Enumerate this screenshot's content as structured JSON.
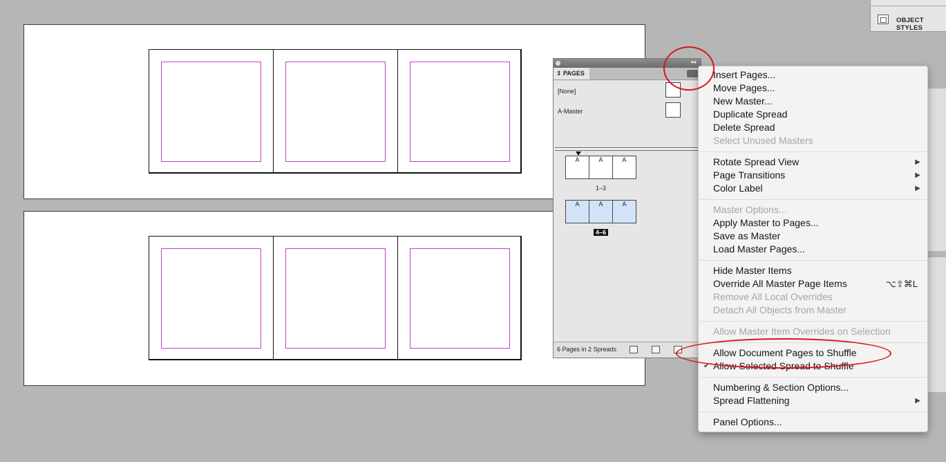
{
  "object_styles": {
    "label": "OBJECT STYLES",
    "icon": "object-styles-icon"
  },
  "pages_panel": {
    "tab_label": "PAGES",
    "collapse_glyph": "◂◂",
    "masters": [
      "[None]",
      "A-Master"
    ],
    "spreads": [
      {
        "pages": [
          "A",
          "A",
          "A"
        ],
        "label": "1–3",
        "selected": false
      },
      {
        "pages": [
          "A",
          "A",
          "A"
        ],
        "label": "4–6",
        "selected": true
      }
    ],
    "footer": {
      "count": "6 Pages in 2 Spreads"
    }
  },
  "menu": {
    "items": [
      {
        "label": "Insert Pages...",
        "disabled": false
      },
      {
        "label": "Move Pages...",
        "disabled": false
      },
      {
        "label": "New Master...",
        "disabled": false
      },
      {
        "label": "Duplicate Spread",
        "disabled": false
      },
      {
        "label": "Delete Spread",
        "disabled": false
      },
      {
        "label": "Select Unused Masters",
        "disabled": true
      },
      {
        "label": "Rotate Spread View",
        "disabled": false,
        "submenu": "▶"
      },
      {
        "label": "Page Transitions",
        "disabled": false,
        "submenu": "▶"
      },
      {
        "label": "Color Label",
        "disabled": false,
        "submenu": "▶"
      },
      {
        "label": "Master Options...",
        "disabled": true
      },
      {
        "label": "Apply Master to Pages...",
        "disabled": false
      },
      {
        "label": "Save as Master",
        "disabled": false
      },
      {
        "label": "Load Master Pages...",
        "disabled": false
      },
      {
        "label": "Hide Master Items",
        "disabled": false
      },
      {
        "label": "Override All Master Page Items",
        "disabled": false,
        "shortcut": "⌥⇧⌘L"
      },
      {
        "label": "Remove All Local Overrides",
        "disabled": true
      },
      {
        "label": "Detach All Objects from Master",
        "disabled": true
      },
      {
        "label": "Allow Master Item Overrides on Selection",
        "disabled": true
      },
      {
        "label": "Allow Document Pages to Shuffle",
        "disabled": false
      },
      {
        "label": "Allow Selected Spread to Shuffle",
        "disabled": false,
        "checked": true,
        "check": "✔"
      },
      {
        "label": "Numbering & Section Options...",
        "disabled": false
      },
      {
        "label": "Spread Flattening",
        "disabled": false,
        "submenu": "▶"
      },
      {
        "label": "Panel Options...",
        "disabled": false
      }
    ]
  },
  "colors": {
    "margin_guide": "#c43ccf",
    "annotation": "#d8141c",
    "selected_page": "#d3e3f7"
  }
}
